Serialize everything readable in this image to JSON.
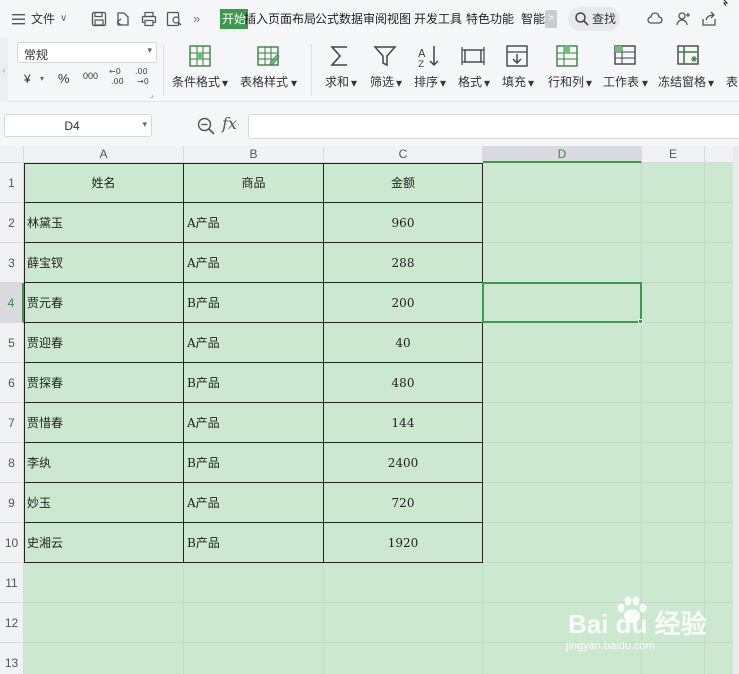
{
  "menubar": {
    "file_label": "文件",
    "tabs": [
      "开始",
      "插入",
      "页面布局",
      "公式",
      "数据",
      "审阅",
      "视图",
      "开发工具",
      "特色功能",
      "智能"
    ],
    "more_label": ">",
    "search_label": "查找"
  },
  "ribbon": {
    "number_format": "常规",
    "currency_symbol": "¥",
    "percent_symbol": "%",
    "thousands_symbol": "000",
    "tools": [
      {
        "label": "条件格式",
        "icon": "conditional-format-icon"
      },
      {
        "label": "表格样式",
        "icon": "table-style-icon"
      },
      {
        "label": "求和",
        "icon": "sum-icon"
      },
      {
        "label": "筛选",
        "icon": "filter-icon"
      },
      {
        "label": "排序",
        "icon": "sort-icon"
      },
      {
        "label": "格式",
        "icon": "format-icon"
      },
      {
        "label": "填充",
        "icon": "fill-icon"
      },
      {
        "label": "行和列",
        "icon": "rows-columns-icon"
      },
      {
        "label": "工作表",
        "icon": "worksheet-icon"
      },
      {
        "label": "冻结窗格",
        "icon": "freeze-panes-icon"
      },
      {
        "label": "表",
        "icon": "table-icon"
      }
    ]
  },
  "formulabar": {
    "cell_ref": "D4",
    "fx_label": "fx",
    "formula": ""
  },
  "sheet": {
    "columns": [
      "A",
      "B",
      "C",
      "D",
      "E"
    ],
    "rows": [
      "1",
      "2",
      "3",
      "4",
      "5",
      "6",
      "7",
      "8",
      "9",
      "10",
      "11",
      "12",
      "13"
    ],
    "active_col": "D",
    "active_row": "4",
    "header": {
      "name": "姓名",
      "product": "商品",
      "amount": "金额"
    },
    "data": [
      {
        "name": "林黛玉",
        "product": "A产品",
        "amount": "960"
      },
      {
        "name": "薛宝钗",
        "product": "A产品",
        "amount": "288"
      },
      {
        "name": "贾元春",
        "product": "B产品",
        "amount": "200"
      },
      {
        "name": "贾迎春",
        "product": "A产品",
        "amount": "40"
      },
      {
        "name": "贾探春",
        "product": "B产品",
        "amount": "480"
      },
      {
        "name": "贾惜春",
        "product": "A产品",
        "amount": "144"
      },
      {
        "name": "李纨",
        "product": "B产品",
        "amount": "2400"
      },
      {
        "name": "妙玉",
        "product": "A产品",
        "amount": "720"
      },
      {
        "name": "史湘云",
        "product": "B产品",
        "amount": "1920"
      }
    ]
  },
  "watermark": {
    "brand": "Bai du 经验",
    "url": "jingyan.baidu.com"
  },
  "colors": {
    "accent": "#3c9a4a",
    "sheet_bg": "#cde8d0"
  }
}
